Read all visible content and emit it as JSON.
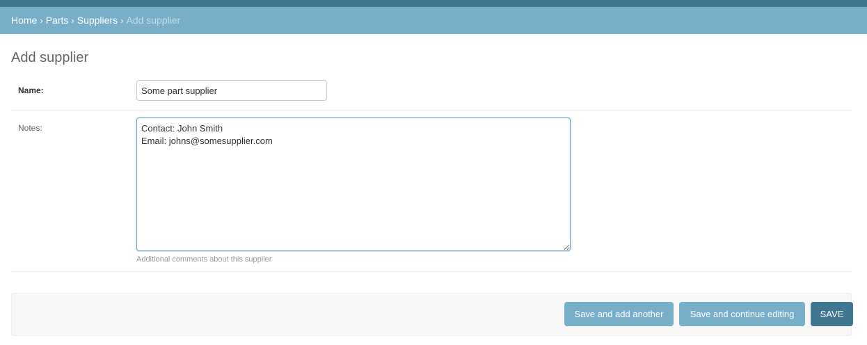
{
  "breadcrumbs": {
    "home": "Home",
    "parts": "Parts",
    "suppliers": "Suppliers",
    "current": "Add supplier",
    "separator": "›"
  },
  "page": {
    "title": "Add supplier"
  },
  "form": {
    "name": {
      "label": "Name:",
      "value": "Some part supplier"
    },
    "notes": {
      "label": "Notes:",
      "value": "Contact: John Smith\nEmail: johns@somesupplier.com",
      "help": "Additional comments about this supplier"
    }
  },
  "actions": {
    "save_add_another": "Save and add another",
    "save_continue": "Save and continue editing",
    "save": "Save"
  },
  "colors": {
    "header": "#417690",
    "breadcrumbs": "#79aec8",
    "button": "#79aec8",
    "primary_button": "#417690"
  }
}
